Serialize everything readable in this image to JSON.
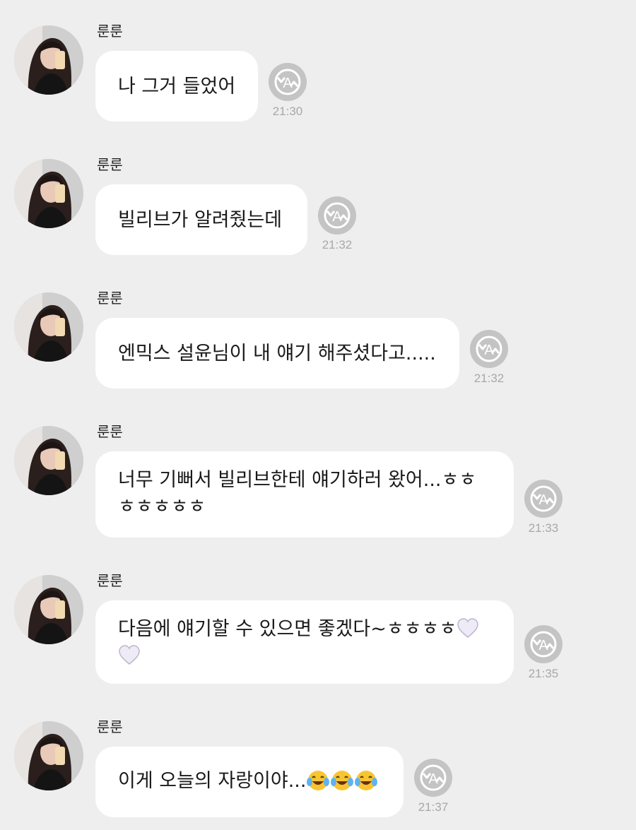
{
  "messages": [
    {
      "sender": "룬룬",
      "lines": [
        "나 그거 들었어"
      ],
      "time": "21:30"
    },
    {
      "sender": "룬룬",
      "lines": [
        "빌리브가 알려줬는데"
      ],
      "time": "21:32"
    },
    {
      "sender": "룬룬",
      "lines": [
        "엔믹스 설윤님이 내 얘기 해주셨다고....."
      ],
      "time": "21:32"
    },
    {
      "sender": "룬룬",
      "lines": [
        "너무 기뻐서 빌리브한테 얘기하러 왔어...ㅎㅎ",
        "ㅎㅎㅎㅎㅎ"
      ],
      "time": "21:33"
    },
    {
      "sender": "룬룬",
      "lines": [
        "다음에 얘기할 수 있으면 좋겠다~ㅎㅎㅎㅎ",
        ""
      ],
      "time": "21:35",
      "heart_emoji": "white-heart-icon"
    },
    {
      "sender": "룬룬",
      "lines": [
        "이게 오늘의 자랑이야..."
      ],
      "time": "21:37",
      "laugh_emoji": "face-with-tears-of-joy-icon"
    }
  ],
  "icons": {
    "translate": "translate-icon",
    "avatar": "avatar"
  },
  "colors": {
    "background": "#eeeeee",
    "bubble": "#ffffff",
    "time": "#a8a8a8",
    "translate_icon": "#c4c4c4"
  }
}
